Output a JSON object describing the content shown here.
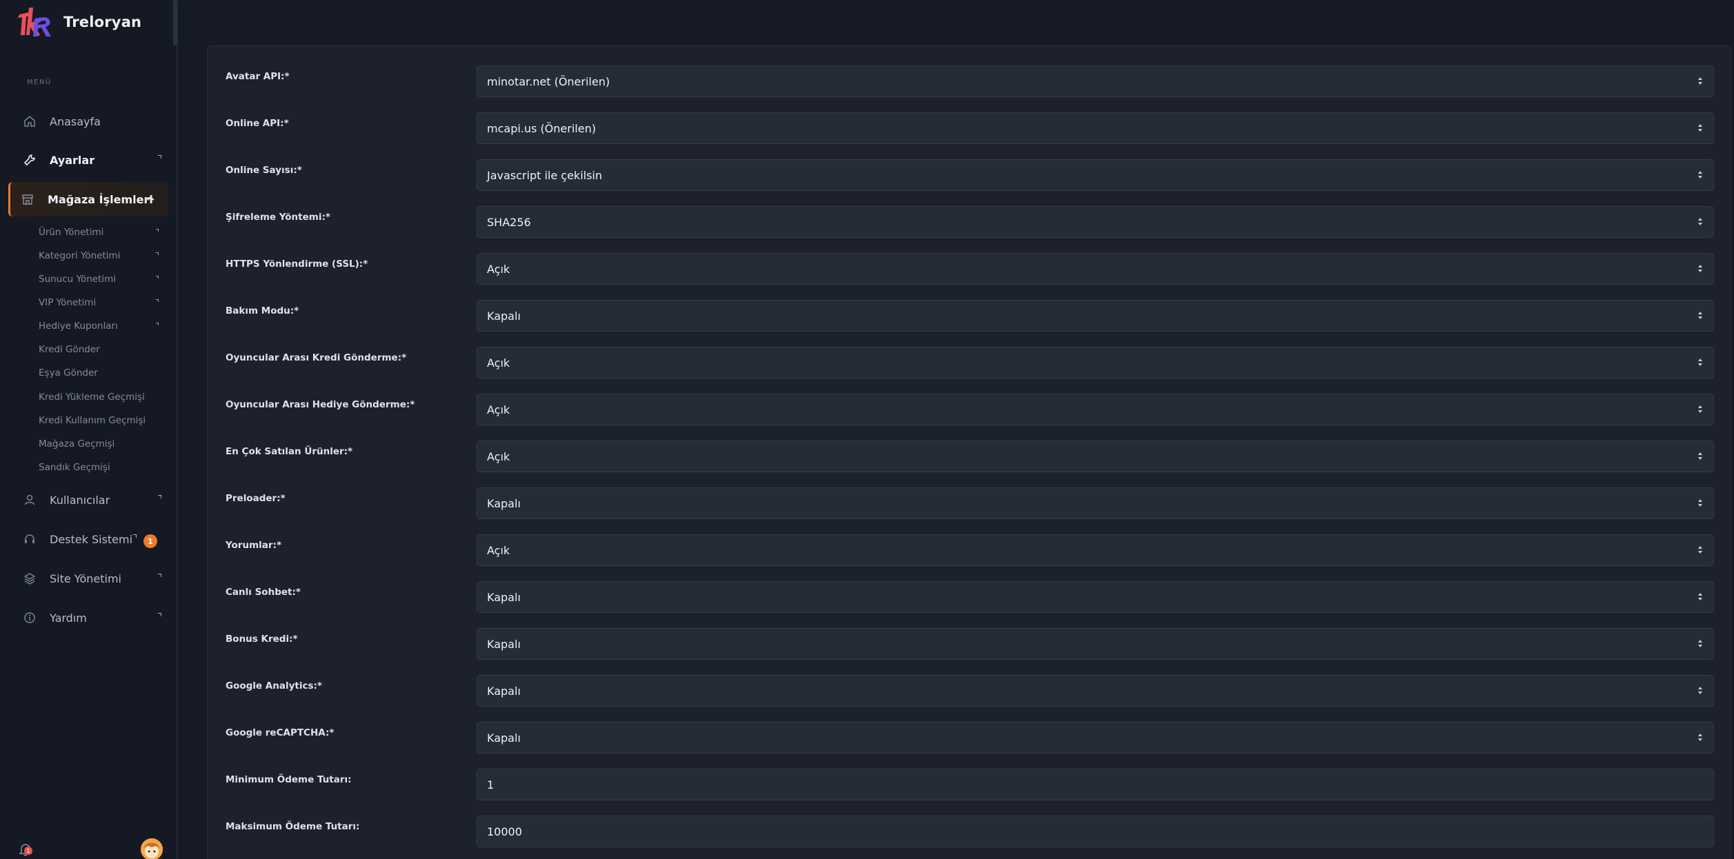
{
  "brand": {
    "name": "Treloryan"
  },
  "menu_label": "MENÜ",
  "nav": {
    "home": "Anasayfa",
    "settings": "Ayarlar",
    "store": "Mağaza İşlemleri",
    "store_sub": [
      "Ürün Yönetimi",
      "Kategori Yönetimi",
      "Sunucu Yönetimi",
      "VIP Yönetimi",
      "Hediye Kuponları",
      "Kredi Gönder",
      "Eşya Gönder",
      "Kredi Yükleme Geçmişi",
      "Kredi Kullanım Geçmişi",
      "Mağaza Geçmişi",
      "Sandık Geçmişi"
    ],
    "users": "Kullanıcılar",
    "support": "Destek Sistemi",
    "support_badge": "1",
    "site": "Site Yönetimi",
    "help": "Yardım"
  },
  "notifications_badge": "1",
  "form": [
    {
      "label": "Avatar API:*",
      "value": "minotar.net (Önerilen)"
    },
    {
      "label": "Online API:*",
      "value": "mcapi.us (Önerilen)"
    },
    {
      "label": "Online Sayısı:*",
      "value": "Javascript ile çekilsin"
    },
    {
      "label": "Şifreleme Yöntemi:*",
      "value": "SHA256"
    },
    {
      "label": "HTTPS Yönlendirme (SSL):*",
      "value": "Açık"
    },
    {
      "label": "Bakım Modu:*",
      "value": "Kapalı"
    },
    {
      "label": "Oyuncular Arası Kredi Gönderme:*",
      "value": "Açık"
    },
    {
      "label": "Oyuncular Arası Hediye Gönderme:*",
      "value": "Açık"
    },
    {
      "label": "En Çok Satılan Ürünler:*",
      "value": "Açık"
    },
    {
      "label": "Preloader:*",
      "value": "Kapalı"
    },
    {
      "label": "Yorumlar:*",
      "value": "Açık"
    },
    {
      "label": "Canlı Sohbet:*",
      "value": "Kapalı"
    },
    {
      "label": "Bonus Kredi:*",
      "value": "Kapalı"
    },
    {
      "label": "Google Analytics:*",
      "value": "Kapalı"
    },
    {
      "label": "Google reCAPTCHA:*",
      "value": "Kapalı"
    },
    {
      "label": "Minimum Ödeme Tutarı:",
      "value": "1"
    },
    {
      "label": "Maksimum Ödeme Tutarı:",
      "value": "10000"
    }
  ]
}
